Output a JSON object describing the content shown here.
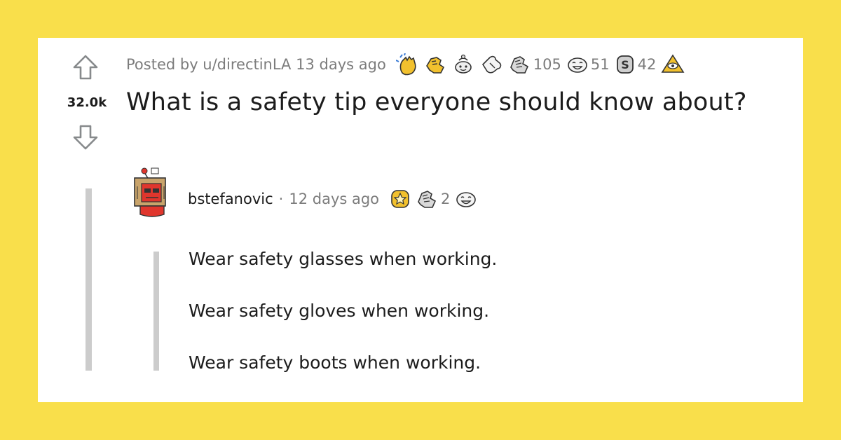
{
  "post": {
    "score": "32.0k",
    "posted_by": "Posted by u/directinLA",
    "time_ago": "13 days ago",
    "title": "What is a safety tip everyone should know about?",
    "awards": [
      {
        "icon": "clapping-hands-award-icon",
        "count": ""
      },
      {
        "icon": "fist-bump-award-icon",
        "count": ""
      },
      {
        "icon": "wholesome-award-icon",
        "count": ""
      },
      {
        "icon": "pointing-hand-award-icon",
        "count": ""
      },
      {
        "icon": "helpful-hands-award-icon",
        "count": "105"
      },
      {
        "icon": "laughing-face-award-icon",
        "count": "51"
      },
      {
        "icon": "silver-award-icon",
        "count": "42"
      },
      {
        "icon": "pyramid-eye-award-icon",
        "count": ""
      }
    ]
  },
  "comment": {
    "username": "bstefanovic",
    "separator": "·",
    "time_ago": "12 days ago",
    "awards": [
      {
        "icon": "gold-star-award-icon",
        "count": ""
      },
      {
        "icon": "helpful-hands-award-icon",
        "count": "2"
      },
      {
        "icon": "laughing-face-award-icon",
        "count": ""
      }
    ],
    "lines": [
      "Wear safety glasses when working.",
      "Wear safety gloves when working.",
      "Wear safety boots when working."
    ]
  },
  "colors": {
    "background": "#f9df4b",
    "card": "#ffffff",
    "thread_line": "#cccccc",
    "text_primary": "#1c1c1c",
    "text_meta": "#7c7c7c",
    "avatar_red": "#e0362d",
    "gold": "#e8b821"
  }
}
